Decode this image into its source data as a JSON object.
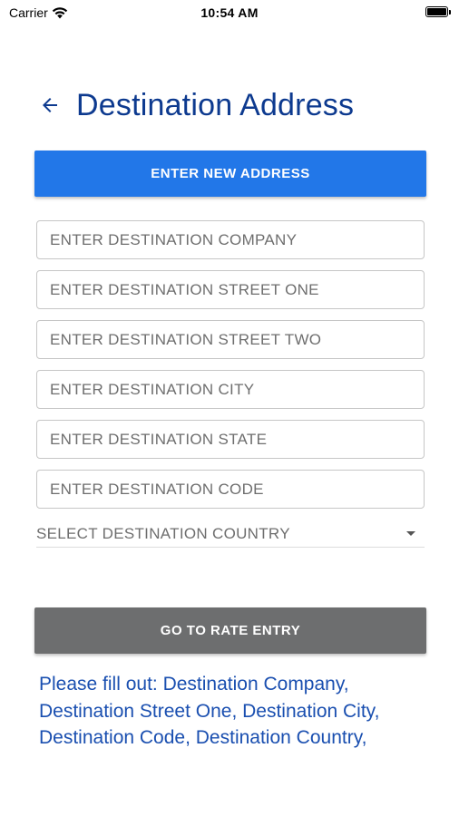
{
  "status_bar": {
    "carrier": "Carrier",
    "time": "10:54 AM",
    "icons": [
      "wifi-icon",
      "battery-icon"
    ]
  },
  "header": {
    "back_icon": "arrow-left-icon",
    "title": "Destination Address"
  },
  "enter_new_address_button": {
    "label": "ENTER NEW ADDRESS",
    "color": "#2277e8"
  },
  "form": {
    "company_placeholder": "ENTER DESTINATION COMPANY",
    "street_one_placeholder": "ENTER DESTINATION STREET ONE",
    "street_two_placeholder": "ENTER DESTINATION STREET TWO",
    "city_placeholder": "ENTER DESTINATION CITY",
    "state_placeholder": "ENTER DESTINATION STATE",
    "code_placeholder": "ENTER DESTINATION CODE",
    "country_select_label": "SELECT DESTINATION COUNTRY"
  },
  "go_to_rate_button": {
    "label": "GO TO RATE ENTRY",
    "color": "#6d6e6f"
  },
  "validation_message": "Please fill out: Destination Company, Destination Street One, Destination City, Destination Code, Destination Country,",
  "colors": {
    "title": "#0d3a8f",
    "message": "#1a4fb0"
  }
}
